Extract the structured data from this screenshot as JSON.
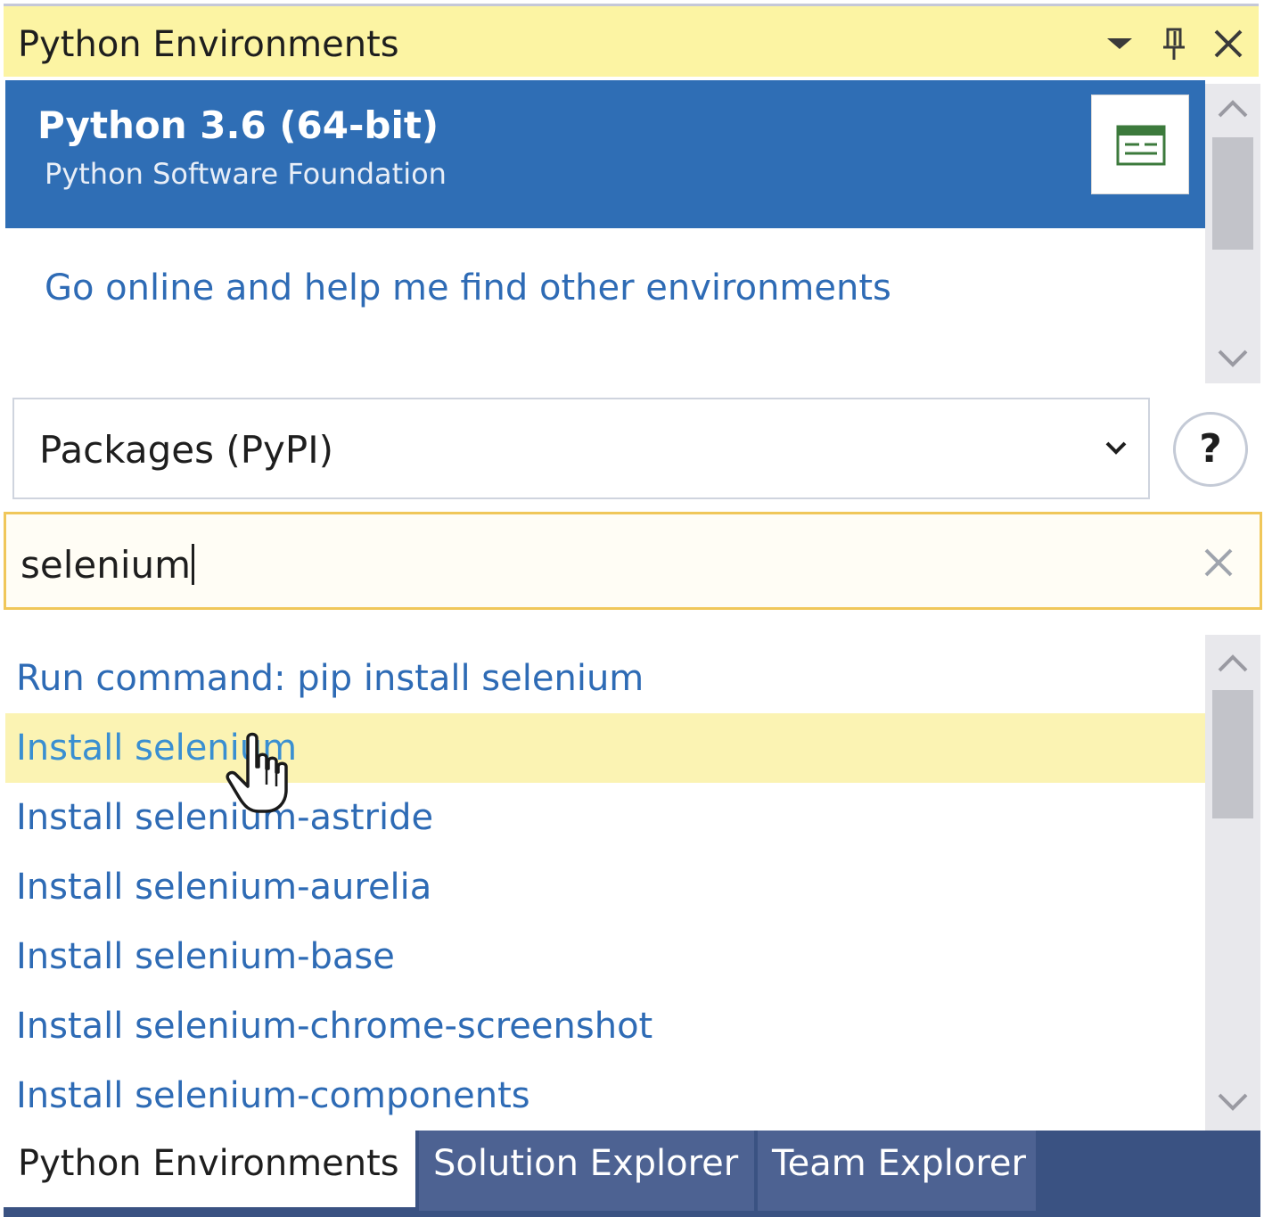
{
  "window": {
    "title": "Python Environments"
  },
  "environments": {
    "selected": {
      "name": "Python 3.6 (64-bit)",
      "vendor": "Python Software Foundation"
    },
    "find_link": "Go online and help me find other environments"
  },
  "packages": {
    "source_selected": "Packages (PyPI)",
    "help_label": "?"
  },
  "search": {
    "query": "selenium"
  },
  "results": {
    "items": [
      "Run command: pip install selenium",
      "Install selenium",
      "Install selenium-astride",
      "Install selenium-aurelia",
      "Install selenium-base",
      "Install selenium-chrome-screenshot",
      "Install selenium-components"
    ],
    "hovered_index": 1
  },
  "tabs": [
    {
      "label": "Python Environments",
      "active": true
    },
    {
      "label": "Solution Explorer",
      "active": false
    },
    {
      "label": "Team Explorer",
      "active": false
    }
  ],
  "colors": {
    "title_bar": "#fcf4a3",
    "selection": "#2f6eb5",
    "link": "#2e6bb5",
    "hover_row": "#fbf3b3",
    "search_border": "#f0c75a",
    "tab_strip": "#3a5282"
  },
  "icons": [
    "dropdown-arrow-icon",
    "pin-icon",
    "close-icon",
    "overview-icon",
    "chevron-up-icon",
    "chevron-down-icon",
    "help-icon",
    "clear-search-icon",
    "hand-cursor-icon"
  ]
}
